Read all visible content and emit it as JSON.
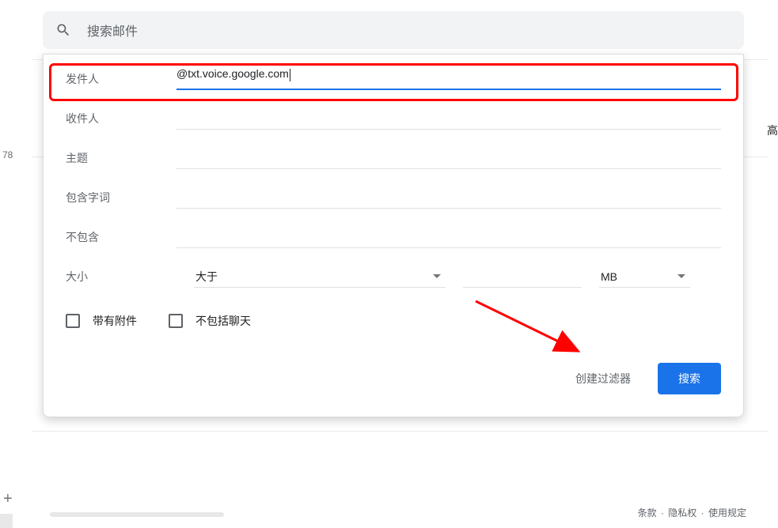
{
  "search": {
    "placeholder": "搜索邮件"
  },
  "form": {
    "from": {
      "label": "发件人",
      "value": "@txt.voice.google.com"
    },
    "to": {
      "label": "收件人"
    },
    "subject": {
      "label": "主题"
    },
    "has_words": {
      "label": "包含字词"
    },
    "not_has": {
      "label": "不包含"
    },
    "size": {
      "label": "大小",
      "compare": "大于",
      "unit": "MB"
    },
    "has_attachment": "带有附件",
    "exclude_chat": "不包括聊天"
  },
  "buttons": {
    "create_filter": "创建过滤器",
    "search": "搜索"
  },
  "sidebar": {
    "count": "78",
    "right_char": "高"
  },
  "footer": {
    "terms": "条款",
    "privacy": "隐私权",
    "policies": "使用规定"
  }
}
